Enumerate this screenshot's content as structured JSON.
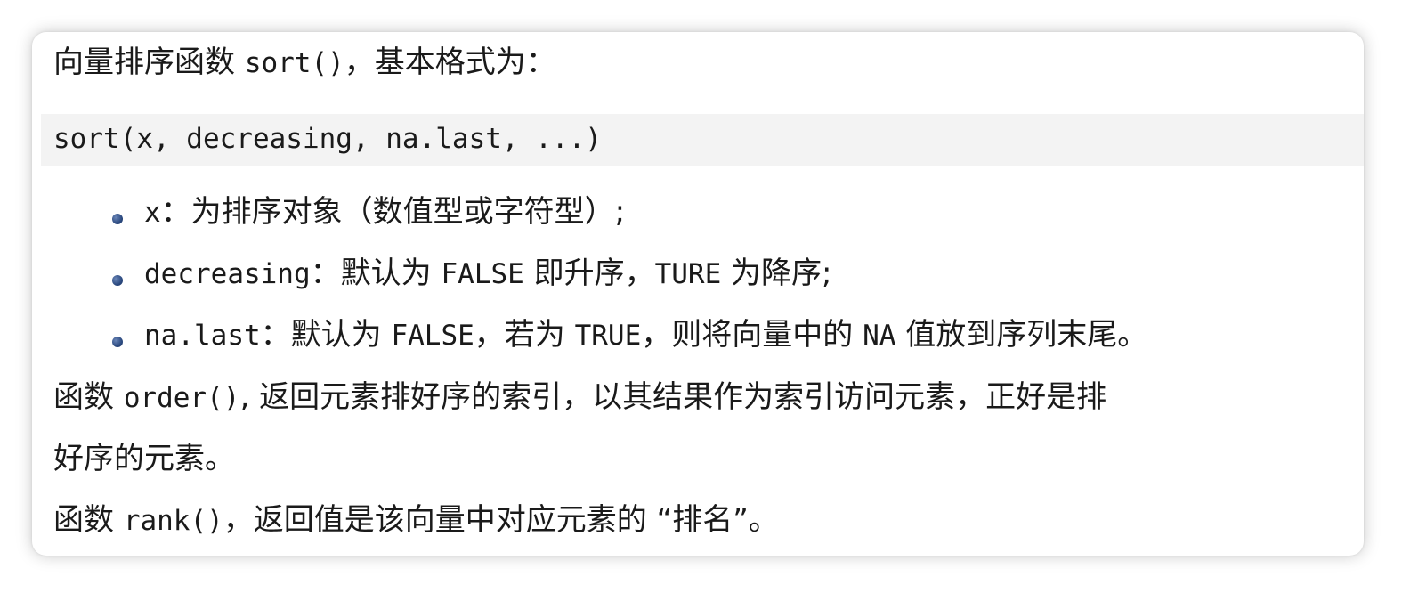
{
  "intro": {
    "text_before": "向量排序函数 ",
    "func": "sort()",
    "text_after": "，基本格式为："
  },
  "code_block": {
    "code": "sort(x, decreasing, na.last, ...)"
  },
  "bullets": [
    {
      "term": "x",
      "desc_1": "：为排序对象（数值型或字符型）;"
    },
    {
      "term": "decreasing",
      "desc_1": "：默认为 ",
      "code_1": "FALSE",
      "desc_2": " 即升序，",
      "code_2": "TURE",
      "desc_3": " 为降序;"
    },
    {
      "term": "na.last",
      "desc_1": "：默认为 ",
      "code_1": "FALSE",
      "desc_2": "，若为 ",
      "code_2": "TRUE",
      "desc_3": "，则将向量中的 ",
      "code_3": "NA",
      "desc_4": " 值放到序列末尾。"
    }
  ],
  "order_para": {
    "text_before": "函数 ",
    "func": "order()",
    "text_line1": ", 返回元素排好序的索引，以其结果作为索引访问元素，正好是排",
    "text_line2": "好序的元素。"
  },
  "rank_para": {
    "text_before": "函数 ",
    "func": "rank()",
    "text_after": "，返回值是该向量中对应元素的 “排名”。"
  }
}
